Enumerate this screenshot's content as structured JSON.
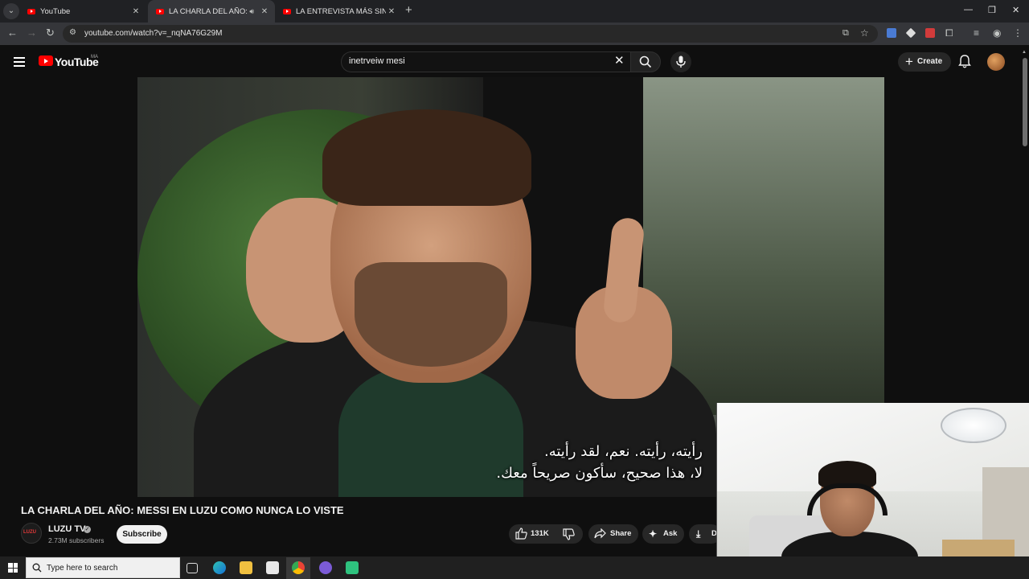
{
  "browser": {
    "tabs": [
      {
        "title": "YouTube",
        "active": false
      },
      {
        "title": "LA CHARLA DEL AÑO: MES",
        "active": true
      },
      {
        "title": "LA ENTREVISTA MÁS SINCERA",
        "active": false
      }
    ],
    "tab_close": "✕",
    "new_tab": "+",
    "url": "youtube.com/watch?v=_nqNA76G29M"
  },
  "youtube": {
    "logo_text": "YouTube",
    "country_code": "MA",
    "search_value": "inetrveiw mesi",
    "create_label": "Create"
  },
  "video": {
    "title": "LA CHARLA DEL AÑO: MESSI EN LUZU COMO NUNCA LO VISTE",
    "subtitles": [
      "رأيته، رأيته. نعم، لقد رأيته.",
      "لا، هذا صحيح، سأكون صريحاً معك."
    ]
  },
  "channel": {
    "name": "LUZU TV",
    "subscribers": "2.73M subscribers",
    "subscribe_label": "Subscribe"
  },
  "actions": {
    "likes": "131K",
    "share_label": "Share",
    "ask_label": "Ask",
    "download_label": "Do"
  },
  "taskbar": {
    "search_placeholder": "Type here to search"
  },
  "colors": {
    "youtube_red": "#ff0000",
    "background": "#0f0f0f",
    "chrome_tab": "#35363a"
  }
}
